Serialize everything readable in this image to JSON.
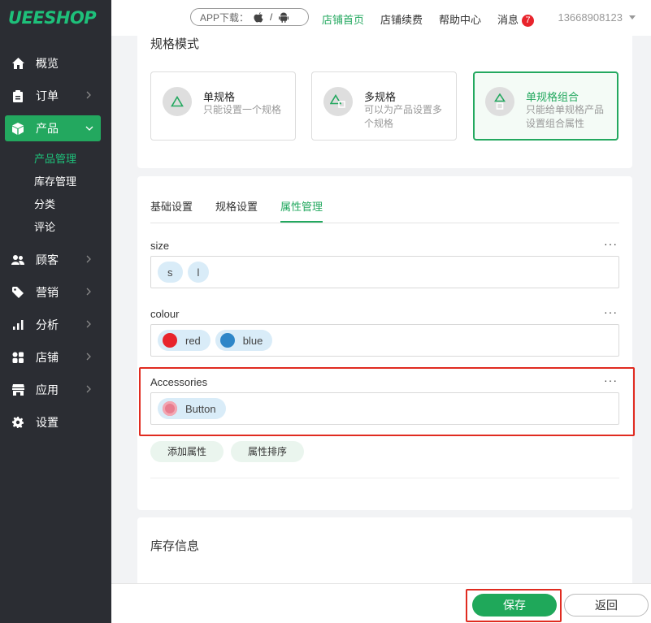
{
  "brand": {
    "logo": "UEESHOP",
    "accent": "#23a85f"
  },
  "sidebar": {
    "items": [
      {
        "label": "概览",
        "icon": "home-icon"
      },
      {
        "label": "订单",
        "icon": "clipboard-icon"
      },
      {
        "label": "产品",
        "icon": "cube-icon"
      },
      {
        "label": "顾客",
        "icon": "users-icon"
      },
      {
        "label": "营销",
        "icon": "tag-icon"
      },
      {
        "label": "分析",
        "icon": "bar-chart-icon"
      },
      {
        "label": "店铺",
        "icon": "grid-icon"
      },
      {
        "label": "应用",
        "icon": "store-icon"
      },
      {
        "label": "设置",
        "icon": "gear-icon"
      }
    ],
    "subitems": [
      "产品管理",
      "库存管理",
      "分类",
      "评论"
    ]
  },
  "header": {
    "app_download": "APP下载：",
    "app_separator": "/",
    "links": [
      "店铺首页",
      "店铺续费",
      "帮助中心"
    ],
    "messages_label": "消息",
    "messages_count": "7",
    "user": "13668908123"
  },
  "spec_mode": {
    "title": "规格模式",
    "options": [
      {
        "title": "单规格",
        "desc": "只能设置一个规格"
      },
      {
        "title": "多规格",
        "desc": "可以为产品设置多个规格"
      },
      {
        "title": "单规格组合",
        "desc": "只能给单规格产品设置组合属性"
      }
    ]
  },
  "tabs": [
    "基础设置",
    "规格设置",
    "属性管理"
  ],
  "attributes": [
    {
      "name": "size",
      "values": [
        {
          "label": "s"
        },
        {
          "label": "l"
        }
      ]
    },
    {
      "name": "colour",
      "values": [
        {
          "label": "red",
          "color": "#e8242c"
        },
        {
          "label": "blue",
          "color": "#2e86c8"
        }
      ]
    },
    {
      "name": "Accessories",
      "values": [
        {
          "label": "Button",
          "color": "#e87d8f"
        }
      ]
    }
  ],
  "more_glyph": "···",
  "actions": {
    "add_attr": "添加属性",
    "sort_attr": "属性排序"
  },
  "stock": {
    "title": "库存信息"
  },
  "footer": {
    "save": "保存",
    "back": "返回"
  }
}
